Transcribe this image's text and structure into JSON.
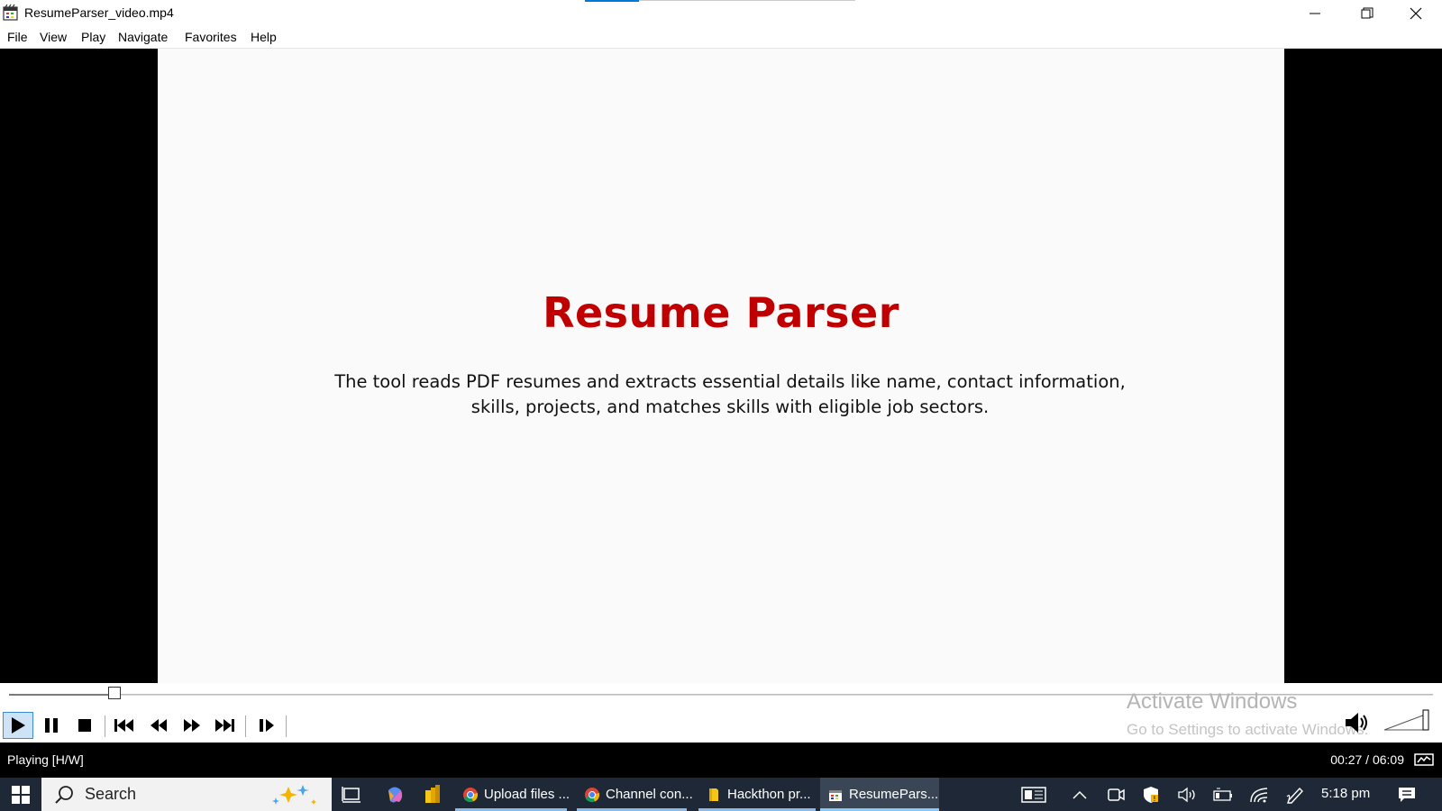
{
  "window": {
    "title": "ResumeParser_video.mp4"
  },
  "menu": [
    "File",
    "View",
    "Play",
    "Navigate",
    "Favorites",
    "Help"
  ],
  "slide": {
    "title": "Resume Parser",
    "body": "The tool reads PDF resumes and extracts essential details like name, contact information, skills, projects, and matches skills with eligible job sectors."
  },
  "playback": {
    "position_fraction": 0.074,
    "volume_fraction": 1.0
  },
  "watermark": {
    "line1": "Activate Windows",
    "line2": "Go to Settings to activate Windows."
  },
  "status": {
    "state": "Playing [H/W]",
    "time": "00:27 / 06:09"
  },
  "taskbar": {
    "search_text": "Search",
    "apps": [
      {
        "label": "Upload files ...",
        "icon": "chrome-icon"
      },
      {
        "label": "Channel con...",
        "icon": "chrome-icon"
      },
      {
        "label": "Hackthon pr...",
        "icon": "folder-icon"
      },
      {
        "label": "ResumePars...",
        "icon": "media-player-icon"
      }
    ],
    "clock": "5:18 pm"
  },
  "colors": {
    "slide_title": "#c00000",
    "taskbar_bg": "#1f2836",
    "accent": "#0078d7"
  }
}
